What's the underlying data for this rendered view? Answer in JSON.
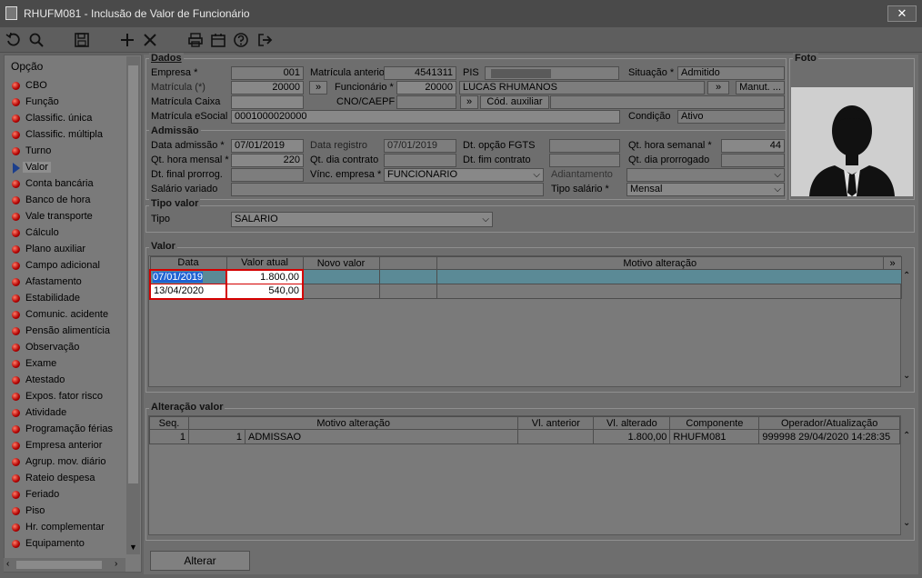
{
  "window": {
    "title": "RHUFM081 - Inclusão de Valor de Funcionário",
    "close": "✕"
  },
  "sidebar": {
    "header": "Opção",
    "items": [
      {
        "label": "CBO"
      },
      {
        "label": "Função"
      },
      {
        "label": "Classific. única"
      },
      {
        "label": "Classific. múltipla"
      },
      {
        "label": "Turno"
      },
      {
        "label": "Valor",
        "selected": true
      },
      {
        "label": "Conta bancária"
      },
      {
        "label": "Banco de hora"
      },
      {
        "label": "Vale transporte"
      },
      {
        "label": "Cálculo"
      },
      {
        "label": "Plano auxiliar"
      },
      {
        "label": "Campo adicional"
      },
      {
        "label": "Afastamento"
      },
      {
        "label": "Estabilidade"
      },
      {
        "label": "Comunic. acidente"
      },
      {
        "label": "Pensão alimentícia"
      },
      {
        "label": "Observação"
      },
      {
        "label": "Exame"
      },
      {
        "label": "Atestado"
      },
      {
        "label": "Expos. fator risco"
      },
      {
        "label": "Atividade"
      },
      {
        "label": "Programação férias"
      },
      {
        "label": "Empresa anterior"
      },
      {
        "label": "Agrup. mov. diário"
      },
      {
        "label": "Rateio despesa"
      },
      {
        "label": "Feriado"
      },
      {
        "label": "Piso"
      },
      {
        "label": "Hr. complementar"
      },
      {
        "label": "Equipamento"
      }
    ]
  },
  "dados": {
    "title": "Dados",
    "empresa_label": "Empresa *",
    "empresa": "001",
    "matricula_anterior_label": "Matrícula anterior",
    "matricula_anterior": "4541311",
    "pis_label": "PIS",
    "situacao_label": "Situação *",
    "situacao": "Admitido",
    "matricula_label": "Matrícula (*)",
    "matricula": "20000",
    "funcionario_label": "Funcionário *",
    "funcionario_id": "20000",
    "funcionario_nome": "LUCAS RHUMANOS",
    "manut_label": "Manut. ...",
    "matricula_caixa_label": "Matrícula Caixa",
    "cno_label": "CNO/CAEPF",
    "cod_auxiliar_label": "Cód. auxiliar",
    "matricula_esocial_label": "Matrícula eSocial",
    "matricula_esocial": "0001000020000",
    "condicao_label": "Condição",
    "condicao": "Ativo",
    "chevron": "»"
  },
  "admissao": {
    "title": "Admissão",
    "dt_admissao_label": "Data admissão *",
    "dt_admissao": "07/01/2019",
    "dt_registro_label": "Data registro",
    "dt_registro": "07/01/2019",
    "dt_opcao_fgts_label": "Dt. opção FGTS",
    "qt_hora_semanal_label": "Qt. hora semanal *",
    "qt_hora_semanal": "44",
    "qt_hora_mensal_label": "Qt. hora mensal *",
    "qt_hora_mensal": "220",
    "qt_dia_contrato_label": "Qt. dia contrato",
    "dt_fim_contrato_label": "Dt. fim contrato",
    "qt_dia_prorrogado_label": "Qt. dia prorrogado",
    "dt_final_prorrog_label": "Dt. final prorrog.",
    "vinc_empresa_label": "Vínc. empresa *",
    "vinc_empresa": "FUNCIONARIO",
    "adiantamento_label": "Adiantamento",
    "salario_variado_label": "Salário variado",
    "tipo_salario_label": "Tipo salário *",
    "tipo_salario": "Mensal"
  },
  "foto": {
    "title": "Foto"
  },
  "tipo_valor": {
    "title": "Tipo valor",
    "tipo_label": "Tipo",
    "tipo": "SALARIO"
  },
  "valor": {
    "title": "Valor",
    "columns": [
      "Data",
      "Valor atual",
      "Novo valor",
      "Motivo alteração"
    ],
    "more": "»",
    "rows": [
      {
        "data": "07/01/2019",
        "valor_atual": "1.800,00"
      },
      {
        "data": "13/04/2020",
        "valor_atual": "540,00"
      }
    ]
  },
  "alteracao": {
    "title": "Alteração valor",
    "columns": [
      "Seq.",
      "Motivo alteração",
      "Vl. anterior",
      "Vl. alterado",
      "Componente",
      "Operador/Atualização"
    ],
    "rows": [
      {
        "seq": "1",
        "motivo_cod": "1",
        "motivo": "ADMISSAO",
        "vl_anterior": "",
        "vl_alterado": "1.800,00",
        "componente": "RHUFM081",
        "operador": "999998",
        "atualizacao": "29/04/2020 14:28:35"
      }
    ]
  },
  "footer": {
    "alterar_label": "Alterar"
  }
}
